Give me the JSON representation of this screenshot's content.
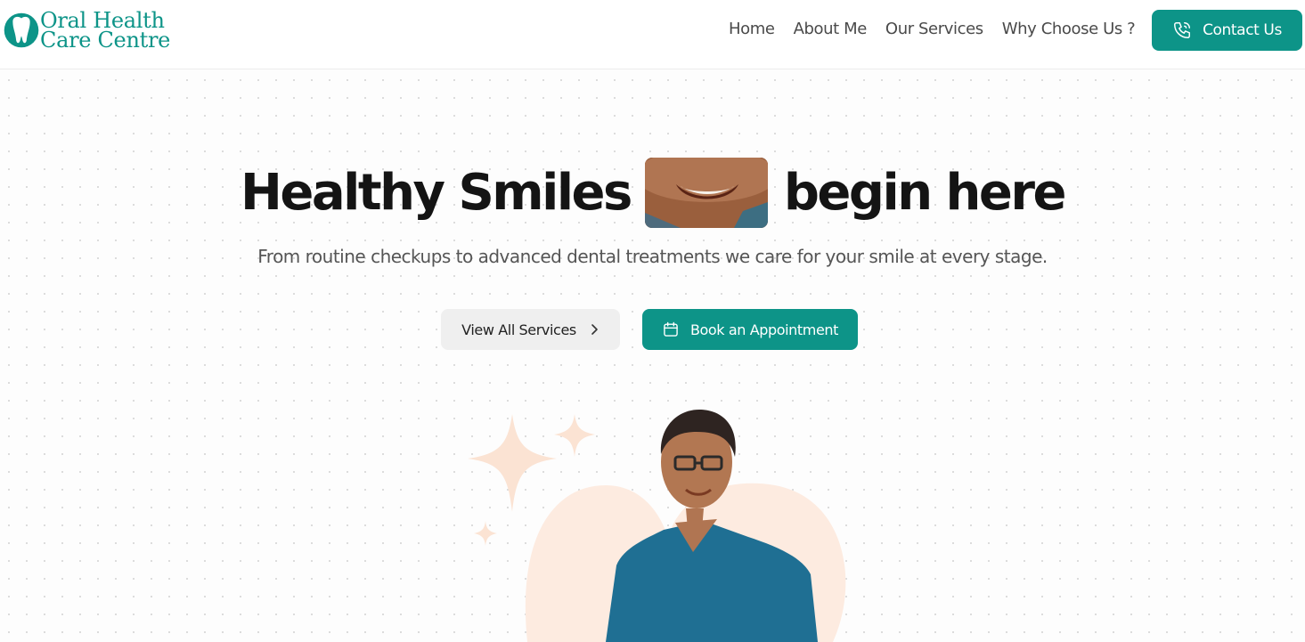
{
  "brand": {
    "logo_line1": "Oral Health",
    "logo_line2": "Care Centre",
    "accent_color": "#0d9488"
  },
  "nav": {
    "items": [
      "Home",
      "About Me",
      "Our Services",
      "Why Choose Us ?"
    ],
    "contact_label": "Contact Us",
    "contact_icon": "phone-icon"
  },
  "hero": {
    "title_part1": "Healthy Smiles",
    "title_part2": "begin here",
    "subtitle": "From routine checkups to advanced dental treatments we care for your smile at every stage.",
    "services_button": "View All Services",
    "services_icon": "chevron-right-icon",
    "book_button": "Book an Appointment",
    "book_icon": "calendar-icon"
  },
  "colors": {
    "blob": "#fdebe0",
    "sparkle": "#fbe3d3",
    "scrubs": "#1f6f93"
  }
}
